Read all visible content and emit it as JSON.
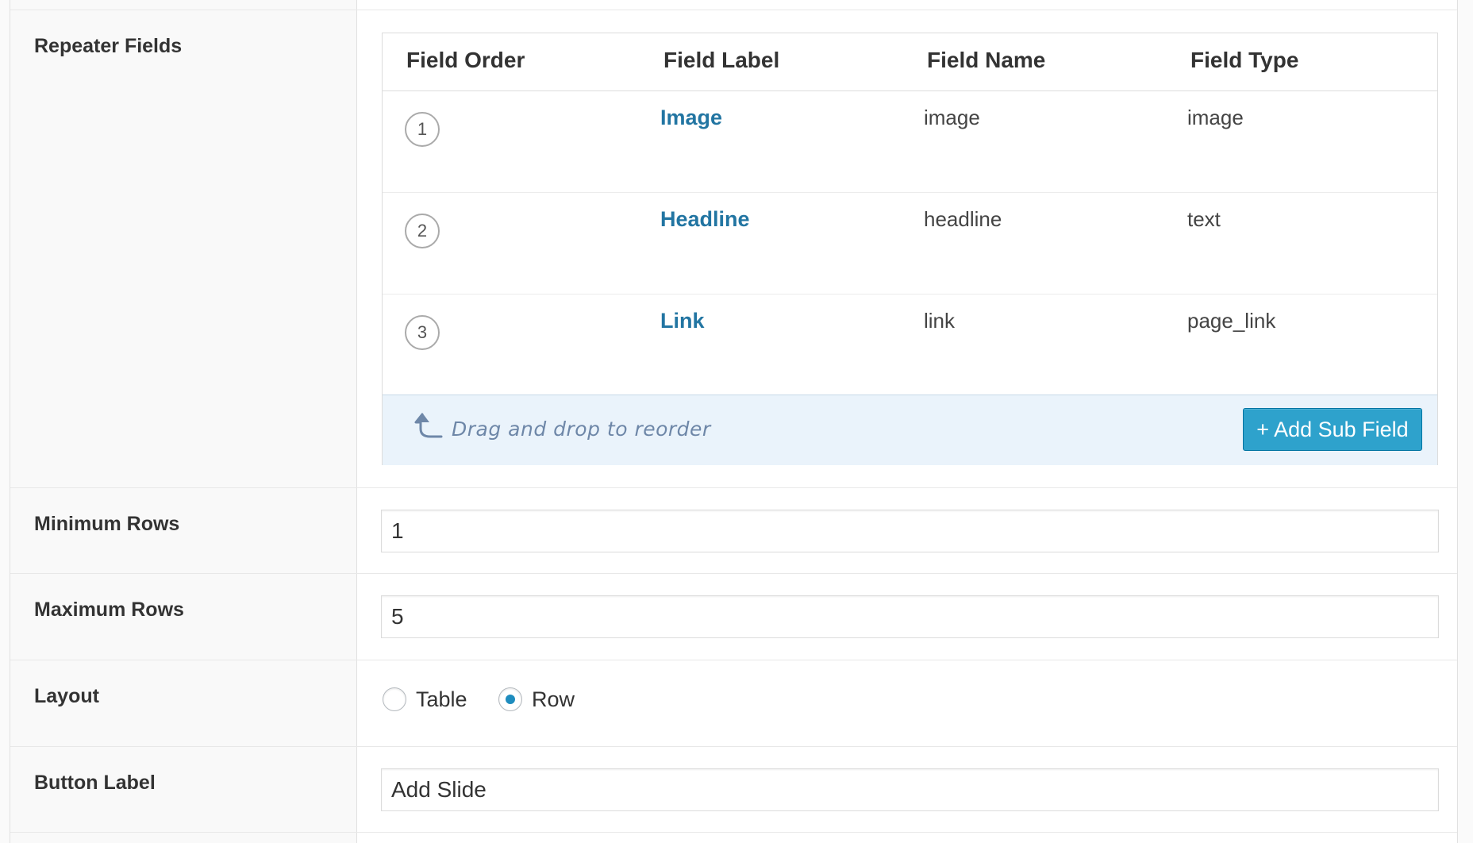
{
  "fields": {
    "repeater_label": "Repeater Fields",
    "min_rows_label": "Minimum Rows",
    "max_rows_label": "Maximum Rows",
    "layout_label": "Layout",
    "button_label_label": "Button Label"
  },
  "subfields": {
    "headers": [
      "Field Order",
      "Field Label",
      "Field Name",
      "Field Type"
    ],
    "rows": [
      {
        "order": "1",
        "label": "Image",
        "name": "image",
        "type": "image"
      },
      {
        "order": "2",
        "label": "Headline",
        "name": "headline",
        "type": "text"
      },
      {
        "order": "3",
        "label": "Link",
        "name": "link",
        "type": "page_link"
      }
    ],
    "drag_hint": "Drag and drop to reorder",
    "add_button": "+ Add Sub Field",
    "drag_icon": "curved-up-arrow-icon"
  },
  "inputs": {
    "min_rows": "1",
    "max_rows": "5",
    "button_label": "Add Slide"
  },
  "layout": {
    "options": [
      "Table",
      "Row"
    ],
    "selected": "Row"
  },
  "colors": {
    "accent": "#2ea2cc",
    "link": "#2275a2",
    "footer_bg": "#eaf3fb"
  }
}
